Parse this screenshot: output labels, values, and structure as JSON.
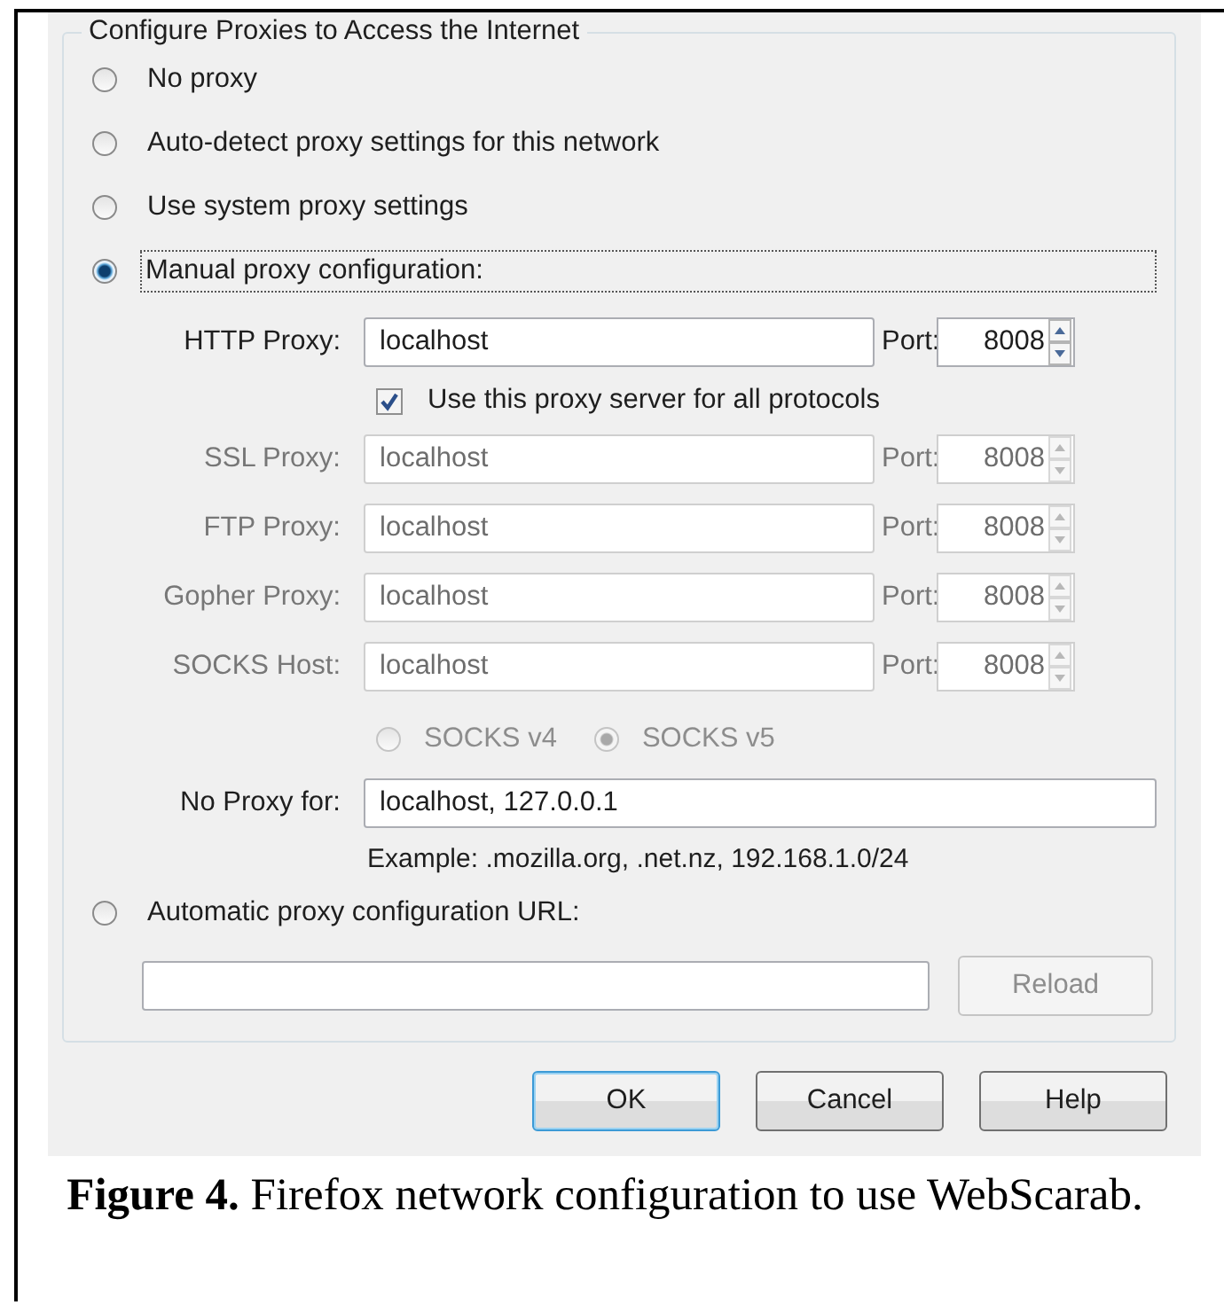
{
  "dialog": {
    "group_title": "Configure Proxies to Access the Internet",
    "options": [
      {
        "kind": "plain",
        "label": "No proxy",
        "selected": false,
        "focused": false
      },
      {
        "kind": "plain",
        "label": "Auto-detect proxy settings for this network",
        "selected": false,
        "focused": false
      },
      {
        "kind": "plain",
        "label": "Use system proxy settings",
        "selected": false,
        "focused": false
      },
      {
        "kind": "manual",
        "label": "Manual proxy configuration:",
        "selected": true,
        "focused": true
      },
      {
        "kind": "auto_url",
        "label": "Automatic proxy configuration URL:",
        "selected": false,
        "focused": false
      }
    ],
    "manual": {
      "http": {
        "label": "HTTP Proxy:",
        "value": "localhost",
        "port_label": "Port:",
        "port": "8008",
        "disabled": false
      },
      "share_all": {
        "label": "Use this proxy server for all protocols",
        "checked": true
      },
      "others": [
        {
          "label": "SSL Proxy:",
          "value": "localhost",
          "port_label": "Port:",
          "port": "8008",
          "disabled": true
        },
        {
          "label": "FTP Proxy:",
          "value": "localhost",
          "port_label": "Port:",
          "port": "8008",
          "disabled": true
        },
        {
          "label": "Gopher Proxy:",
          "value": "localhost",
          "port_label": "Port:",
          "port": "8008",
          "disabled": true
        },
        {
          "label": "SOCKS Host:",
          "value": "localhost",
          "port_label": "Port:",
          "port": "8008",
          "disabled": true
        }
      ],
      "socks_versions": [
        {
          "label": "SOCKS v4",
          "selected": false,
          "disabled": true
        },
        {
          "label": "SOCKS v5",
          "selected": true,
          "disabled": true
        }
      ],
      "no_proxy": {
        "label": "No Proxy for:",
        "value": "localhost, 127.0.0.1"
      },
      "example": "Example: .mozilla.org, .net.nz, 192.168.1.0/24"
    },
    "reload": {
      "label": "Reload",
      "disabled": true
    },
    "buttons": [
      {
        "label": "OK",
        "default": true
      },
      {
        "label": "Cancel",
        "default": false
      },
      {
        "label": "Help",
        "default": false
      }
    ]
  },
  "caption": "**Figure 4.** Firefox network configuration to use WebScarab."
}
